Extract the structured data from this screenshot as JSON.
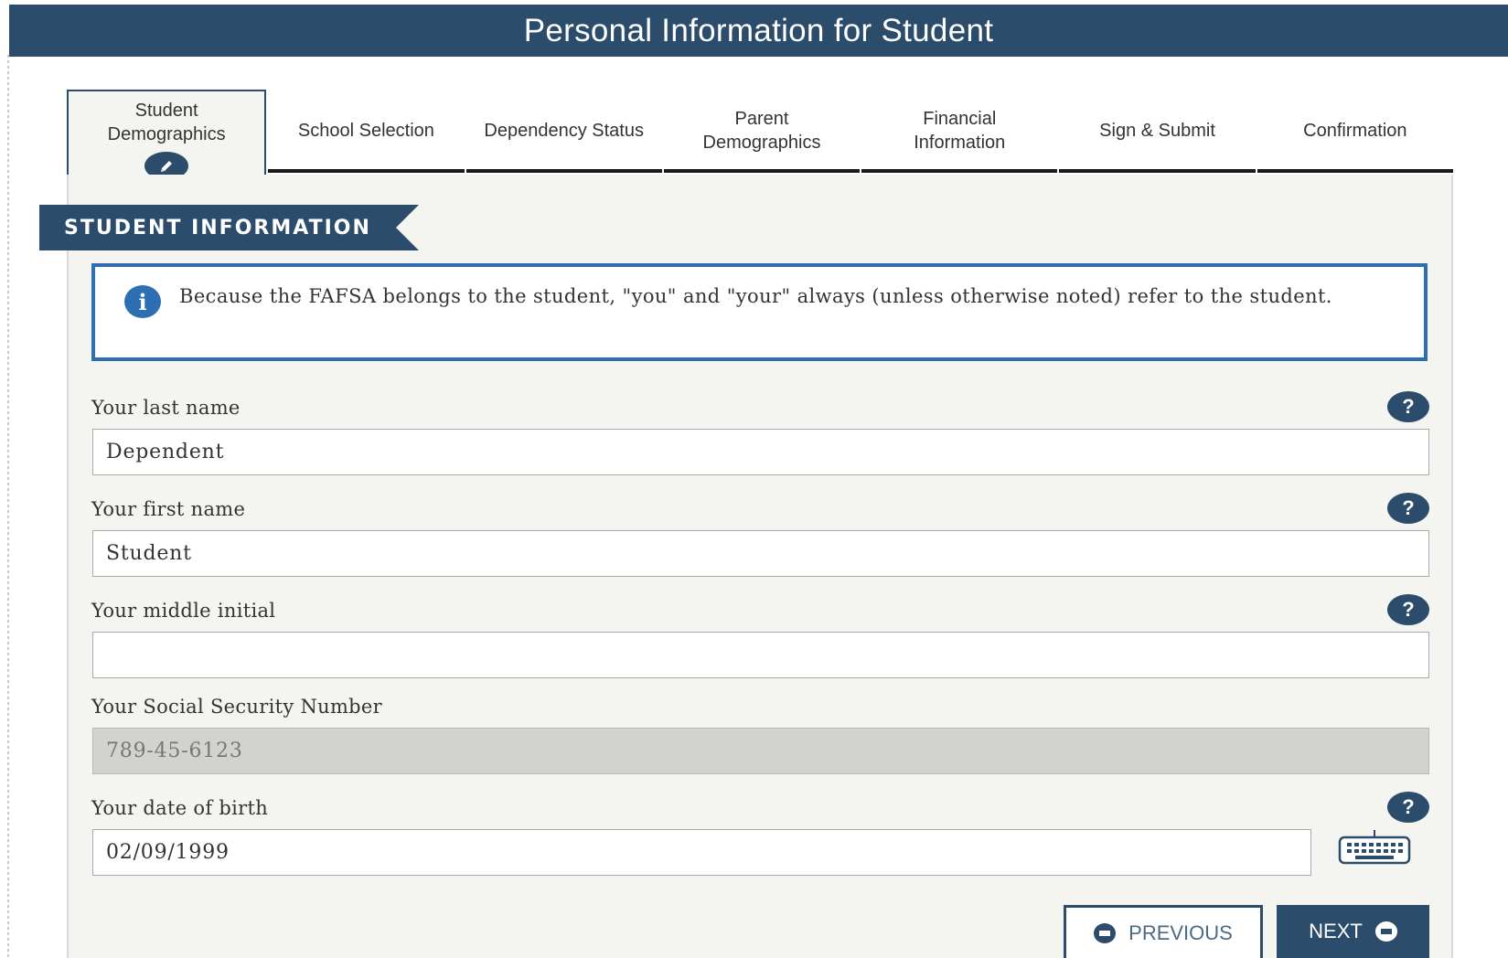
{
  "window": {
    "title": "Personal Information for Student"
  },
  "tabs": [
    {
      "label": "Student\nDemographics",
      "active": true
    },
    {
      "label": "School Selection"
    },
    {
      "label": "Dependency Status"
    },
    {
      "label": "Parent\nDemographics"
    },
    {
      "label": "Financial\nInformation"
    },
    {
      "label": "Sign & Submit"
    },
    {
      "label": "Confirmation"
    }
  ],
  "section": {
    "heading": "STUDENT INFORMATION"
  },
  "info": {
    "icon": "info-icon",
    "text": "Because the FAFSA belongs to the student, \"you\" and \"your\" always (unless otherwise noted) refer to the student."
  },
  "fields": {
    "last_name": {
      "label": "Your last name",
      "value": "Dependent",
      "help": "?"
    },
    "first_name": {
      "label": "Your first name",
      "value": "Student",
      "help": "?"
    },
    "middle_initial": {
      "label": "Your middle initial",
      "value": "",
      "help": "?"
    },
    "ssn": {
      "label": "Your Social Security Number",
      "value": "789-45-6123"
    },
    "dob": {
      "label": "Your date of birth",
      "value": "02/09/1999",
      "help": "?"
    }
  },
  "buttons": {
    "previous": "PREVIOUS",
    "next": "NEXT"
  },
  "colors": {
    "navy": "#2b4c6a",
    "info_blue": "#2e6fb3",
    "panel_bg": "#f4f4f1",
    "disabled_bg": "#d2d2ce"
  }
}
